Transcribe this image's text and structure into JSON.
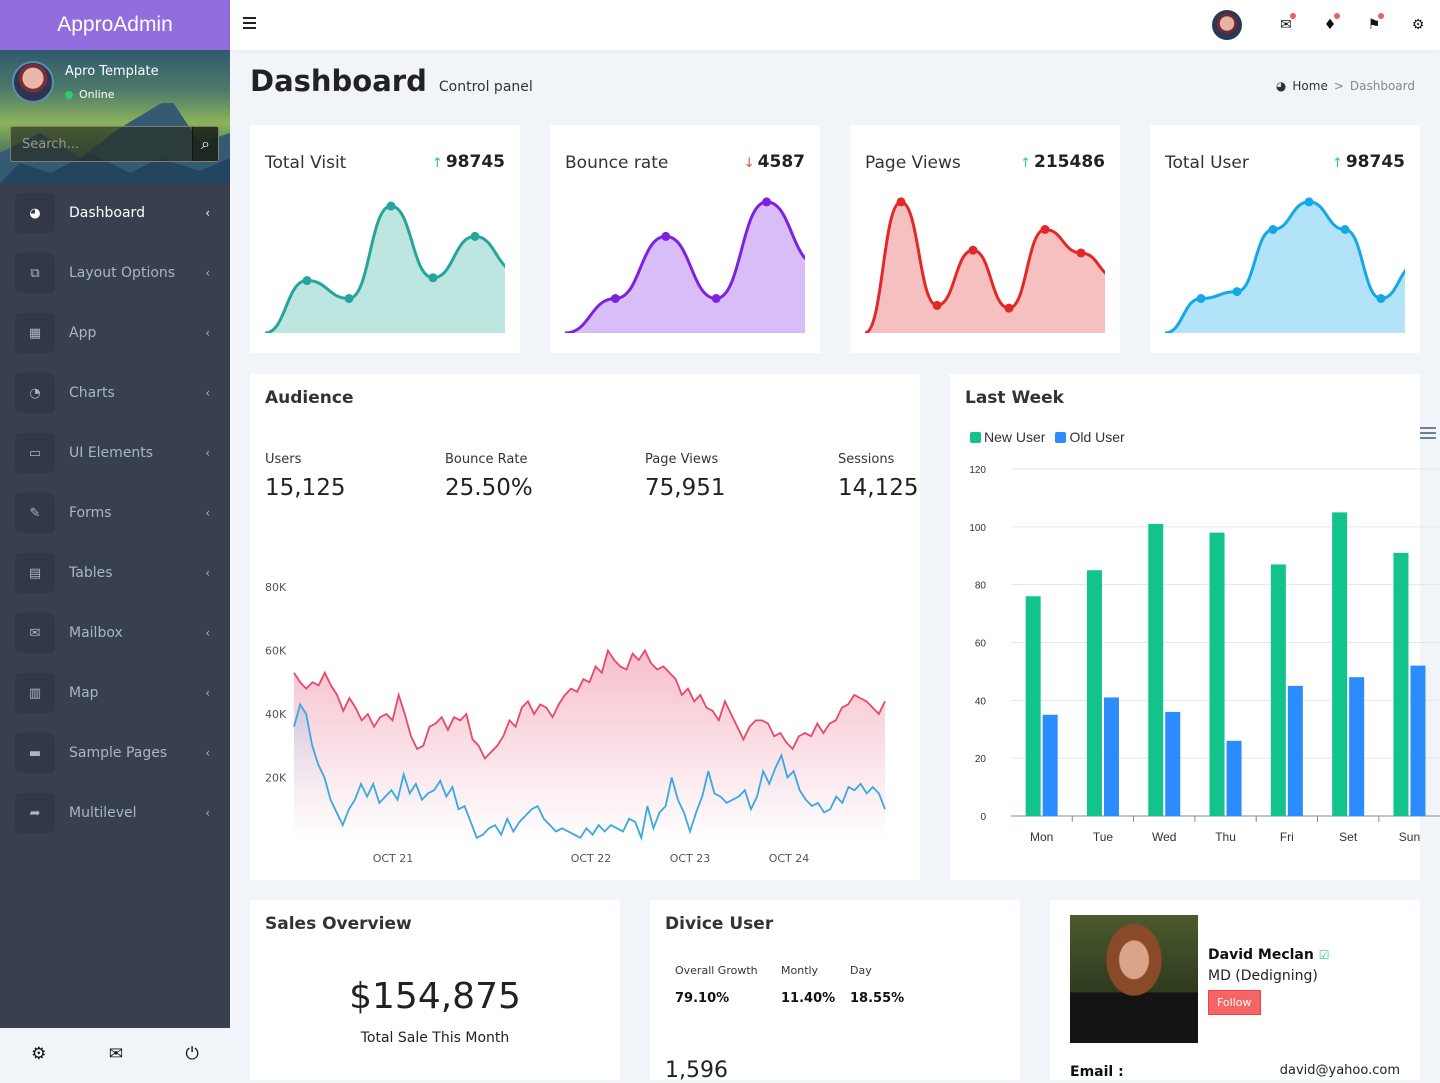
{
  "app": {
    "brand": "ApproAdmin"
  },
  "sidebar": {
    "user": {
      "name": "Apro Template",
      "status": "Online"
    },
    "search": {
      "placeholder": "Search..."
    },
    "items": [
      {
        "label": "Dashboard",
        "icon": "dashboard-icon",
        "glyph": "◕",
        "active": true
      },
      {
        "label": "Layout Options",
        "icon": "copy-icon",
        "glyph": "⧉"
      },
      {
        "label": "App",
        "icon": "grid-icon",
        "glyph": "▦"
      },
      {
        "label": "Charts",
        "icon": "pie-chart-icon",
        "glyph": "◔"
      },
      {
        "label": "UI Elements",
        "icon": "laptop-icon",
        "glyph": "▭"
      },
      {
        "label": "Forms",
        "icon": "edit-icon",
        "glyph": "✎"
      },
      {
        "label": "Tables",
        "icon": "table-icon",
        "glyph": "▤"
      },
      {
        "label": "Mailbox",
        "icon": "envelope-icon",
        "glyph": "✉"
      },
      {
        "label": "Map",
        "icon": "map-icon",
        "glyph": "▥"
      },
      {
        "label": "Sample Pages",
        "icon": "folder-icon",
        "glyph": "▬"
      },
      {
        "label": "Multilevel",
        "icon": "share-icon",
        "glyph": "➦"
      }
    ],
    "chevron": "‹",
    "footer": {
      "settings": "⚙",
      "mail": "✉",
      "power": "⏻"
    }
  },
  "header": {
    "menu_icon": "≡",
    "icons": {
      "mail": "✉",
      "bell": "🔔",
      "flag": "⚑",
      "gear": "⚙"
    }
  },
  "page": {
    "title": "Dashboard",
    "subtitle": "Control panel",
    "breadcrumb": {
      "home_icon": "◕",
      "home": "Home",
      "sep": ">",
      "current": "Dashboard"
    }
  },
  "stats": [
    {
      "title": "Total Visit",
      "value": "98745",
      "trend": "↑",
      "trend_color": "#2ecc71",
      "color": "#26a69a",
      "fill": "#bde6e1",
      "points": [
        0,
        38,
        25,
        92,
        40,
        70,
        45
      ]
    },
    {
      "title": "Bounce rate",
      "value": "4587",
      "trend": "↓",
      "trend_color": "#e74c3c",
      "color": "#7e22e0",
      "fill": "#d9bdf7",
      "points": [
        0,
        25,
        70,
        25,
        95,
        50
      ]
    },
    {
      "title": "Page Views",
      "value": "215486",
      "trend": "↑",
      "trend_color": "#2ecc71",
      "color": "#e32828",
      "fill": "#f7c0c0",
      "points": [
        0,
        95,
        20,
        60,
        18,
        75,
        58,
        40
      ]
    },
    {
      "title": "Total User",
      "value": "98745",
      "trend": "↑",
      "trend_color": "#2ecc71",
      "color": "#14a8e6",
      "fill": "#b3e3f8",
      "points": [
        0,
        25,
        30,
        75,
        95,
        75,
        25,
        50
      ]
    }
  ],
  "audience": {
    "title": "Audience",
    "stats": [
      {
        "label": "Users",
        "value": "15,125"
      },
      {
        "label": "Bounce Rate",
        "value": "25.50%"
      },
      {
        "label": "Page Views",
        "value": "75,951"
      },
      {
        "label": "Sessions",
        "value": "14,125"
      }
    ]
  },
  "chart_data": [
    {
      "type": "area",
      "title": "Audience",
      "yticks": [
        "80K",
        "60K",
        "40K",
        "20K"
      ],
      "ylim": [
        0,
        80000
      ],
      "xticks": [
        "OCT 21",
        "OCT 22",
        "OCT 23",
        "OCT 24"
      ],
      "series": [
        {
          "name": "Page Views",
          "color": "#e8496b",
          "values": [
            53000,
            50000,
            48000,
            50000,
            49000,
            53000,
            49000,
            46000,
            41000,
            45000,
            42000,
            38000,
            40000,
            36000,
            39000,
            40000,
            38000,
            46000,
            40000,
            33000,
            29000,
            30000,
            36000,
            37000,
            39000,
            35000,
            39000,
            38000,
            40000,
            32000,
            30000,
            26000,
            28000,
            30000,
            33000,
            38000,
            36000,
            42000,
            44000,
            40000,
            43000,
            42000,
            39000,
            43000,
            46000,
            48000,
            47000,
            51000,
            50000,
            55000,
            53000,
            60000,
            57000,
            55000,
            54000,
            59000,
            57000,
            60000,
            56000,
            54000,
            55000,
            53000,
            51000,
            46000,
            48000,
            44000,
            46000,
            42000,
            41000,
            38000,
            44000,
            40000,
            36000,
            32000,
            36000,
            38000,
            38000,
            37000,
            33000,
            34000,
            31000,
            29000,
            33000,
            34000,
            33000,
            37000,
            34000,
            37000,
            38000,
            42000,
            43000,
            46000,
            45000,
            44000,
            42000,
            40000,
            44000
          ]
        },
        {
          "name": "Sessions",
          "color": "#3ba8e0",
          "values": [
            36000,
            43000,
            40000,
            30000,
            24000,
            20000,
            13000,
            9000,
            5000,
            10000,
            13000,
            18000,
            14000,
            18000,
            12000,
            14000,
            16000,
            13000,
            21000,
            15000,
            18000,
            13000,
            15000,
            16000,
            19000,
            14000,
            17000,
            10000,
            11000,
            6000,
            1000,
            2000,
            4000,
            5000,
            2000,
            7000,
            3000,
            6000,
            8000,
            10000,
            11000,
            7000,
            5000,
            3000,
            4000,
            3000,
            2000,
            1000,
            4000,
            2000,
            5000,
            3000,
            5000,
            4000,
            3000,
            7000,
            6000,
            1000,
            11000,
            4000,
            9000,
            11000,
            20000,
            13000,
            9000,
            3000,
            9000,
            14000,
            22000,
            15000,
            14000,
            12000,
            13000,
            14000,
            16000,
            10000,
            14000,
            22000,
            18000,
            23000,
            27000,
            20000,
            22000,
            16000,
            13000,
            11000,
            12000,
            9000,
            10000,
            14000,
            12000,
            17000,
            16000,
            18000,
            15000,
            17000,
            15000,
            10000
          ]
        }
      ]
    },
    {
      "type": "bar",
      "title": "Last Week",
      "categories": [
        "Mon",
        "Tue",
        "Wed",
        "Thu",
        "Fri",
        "Set",
        "Sun"
      ],
      "series": [
        {
          "name": "New User",
          "color": "#13c38c",
          "values": [
            76,
            85,
            101,
            98,
            87,
            105,
            91
          ]
        },
        {
          "name": "Old User",
          "color": "#2a8cff",
          "values": [
            35,
            41,
            36,
            26,
            45,
            48,
            52
          ]
        }
      ],
      "ylim": [
        0,
        120
      ],
      "yticks": [
        "0",
        "20",
        "40",
        "60",
        "80",
        "100",
        "120"
      ],
      "legend": "top-left"
    }
  ],
  "sales": {
    "title": "Sales Overview",
    "amount": "$154,875",
    "caption": "Total Sale This Month"
  },
  "device": {
    "title": "Divice User",
    "cols": [
      {
        "h": "Overall Growth",
        "v": "79.10%"
      },
      {
        "h": "Montly",
        "v": "11.40%"
      },
      {
        "h": "Day",
        "v": "18.55%"
      }
    ],
    "count": "1,596"
  },
  "profile": {
    "name": "David Meclan",
    "role": "MD (Dedigning)",
    "follow": "Follow",
    "email_label": "Email :",
    "email": "david@yahoo.com"
  }
}
